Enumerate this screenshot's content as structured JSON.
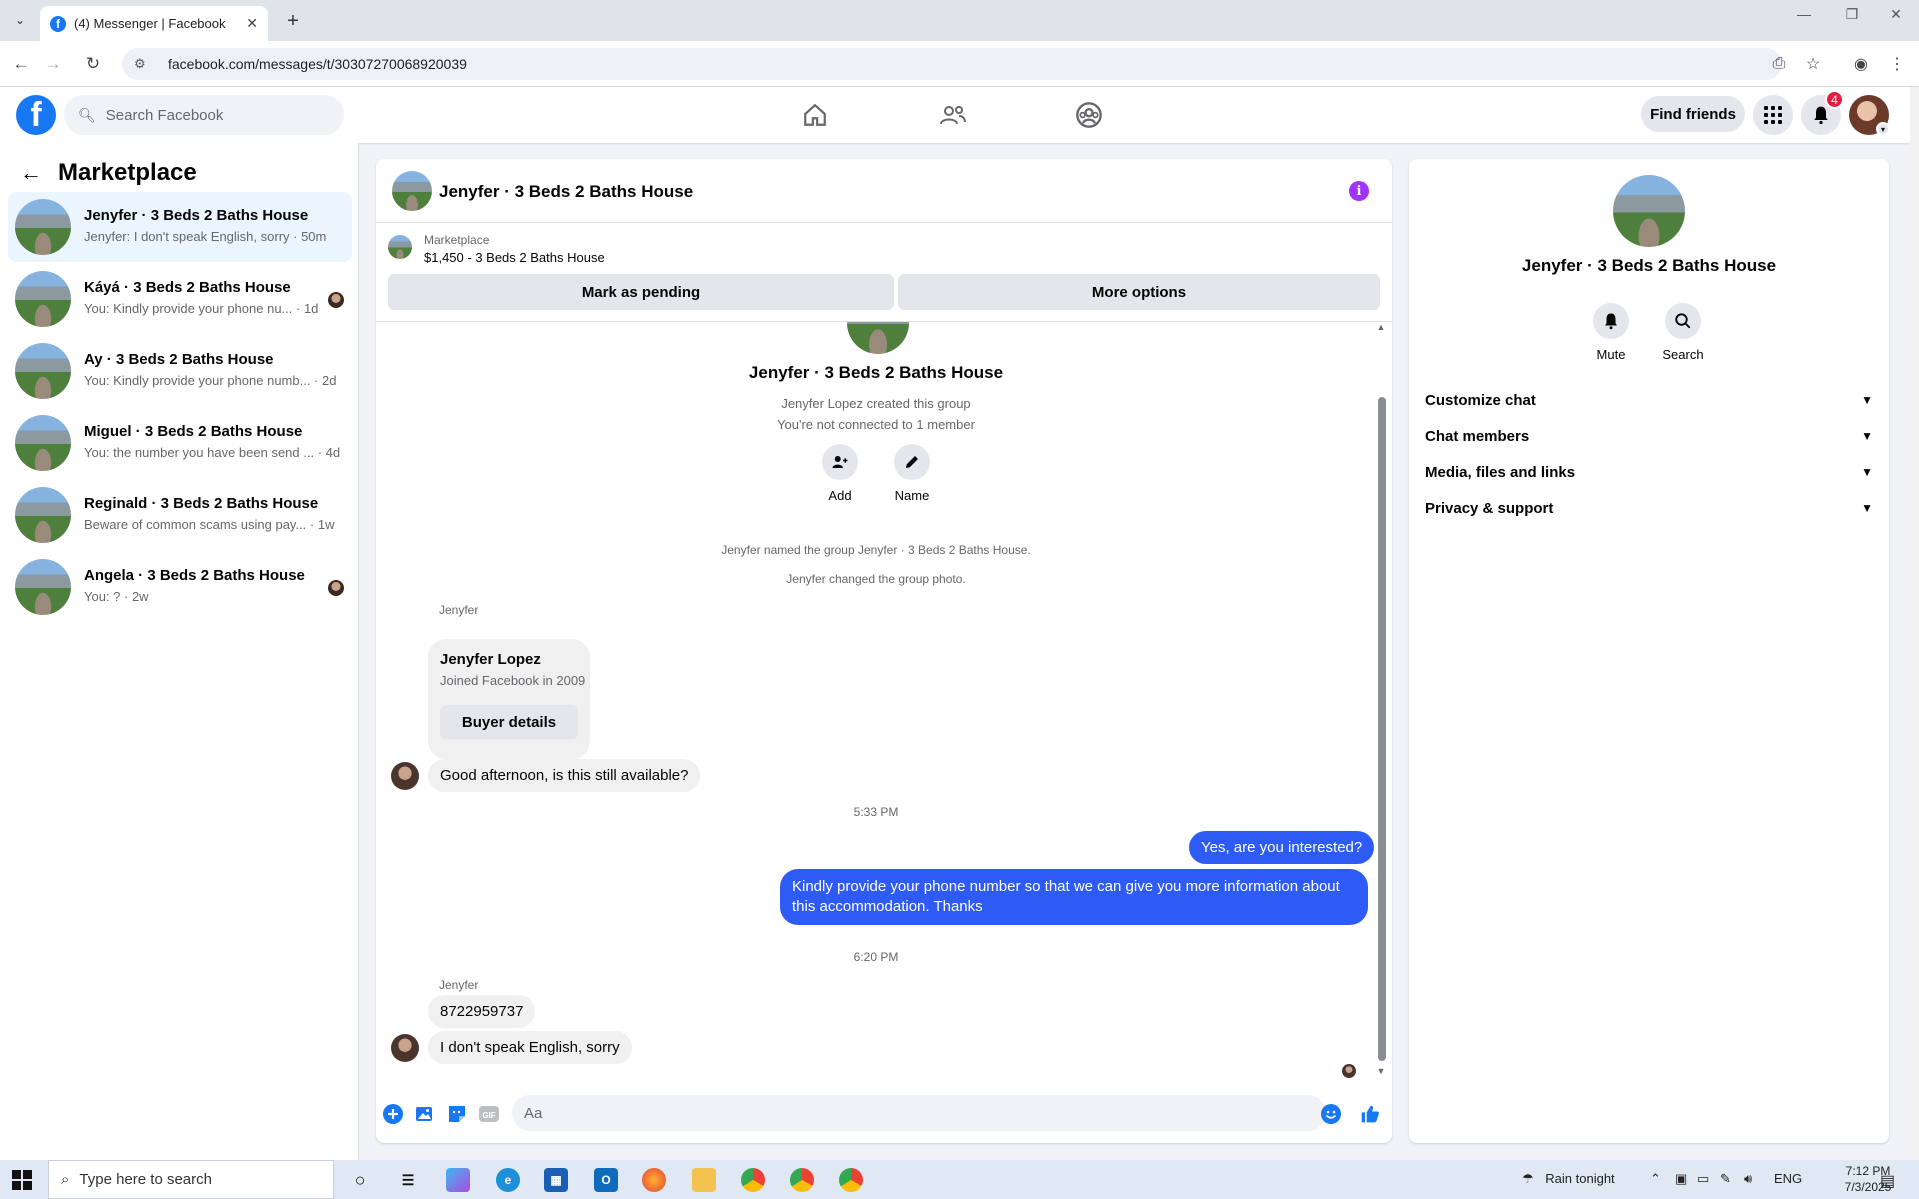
{
  "browser": {
    "tab_title": "(4) Messenger | Facebook",
    "url": "facebook.com/messages/t/30307270068920039"
  },
  "fb": {
    "search_placeholder": "Search Facebook",
    "find_friends": "Find friends",
    "notification_count": "4",
    "brand_color": "#1877f2"
  },
  "sidebar": {
    "title": "Marketplace",
    "conversations": [
      {
        "name": "Jenyfer · 3 Beds 2 Baths House",
        "preview": "Jenyfer: I don't speak English, sorry · 50m",
        "active": true
      },
      {
        "name": "Káyá · 3 Beds 2 Baths House",
        "preview": "You: Kindly provide your phone nu... · 1d"
      },
      {
        "name": "Ay · 3 Beds 2 Baths House",
        "preview": "You: Kindly provide your phone numb... · 2d"
      },
      {
        "name": "Miguel · 3 Beds 2 Baths House",
        "preview": "You: the number you have been send ... · 4d"
      },
      {
        "name": "Reginald · 3 Beds 2 Baths House",
        "preview": "Beware of common scams using pay... · 1w"
      },
      {
        "name": "Angela · 3 Beds 2 Baths House",
        "preview": "You: ? · 2w"
      }
    ]
  },
  "chat": {
    "title": "Jenyfer · 3 Beds 2 Baths House",
    "marketplace_label": "Marketplace",
    "listing": "$1,450 - 3 Beds 2 Baths House",
    "mark_pending": "Mark as pending",
    "more_options": "More options",
    "group_title": "Jenyfer · 3 Beds 2 Baths House",
    "created_by": "Jenyfer Lopez created this group",
    "not_connected": "You're not connected to 1 member",
    "add_label": "Add",
    "name_label": "Name",
    "sys_named": "Jenyfer named the group Jenyfer · 3 Beds 2 Baths House.",
    "sys_photo": "Jenyfer changed the group photo.",
    "sender": "Jenyfer",
    "card_name": "Jenyfer Lopez",
    "card_joined": "Joined Facebook in 2009",
    "card_button": "Buyer details",
    "msg1": "Good afternoon, is this still available?",
    "time1": "5:33 PM",
    "out1": "Yes, are you interested?",
    "out2": "Kindly provide your phone number so that we can give you more information about this accommodation. Thanks",
    "time2": "6:20 PM",
    "msg2": "8722959737",
    "msg3": "I don't speak English, sorry",
    "composer_placeholder": "Aa",
    "outgoing_color": "#2e5bf5"
  },
  "info_panel": {
    "name": "Jenyfer · 3 Beds 2 Baths House",
    "mute": "Mute",
    "search": "Search",
    "sections": [
      "Customize chat",
      "Chat members",
      "Media, files and links",
      "Privacy & support"
    ]
  },
  "taskbar": {
    "search_placeholder": "Type here to search",
    "weather": "Rain tonight",
    "lang": "ENG",
    "time": "7:12 PM",
    "date": "7/3/2025"
  }
}
